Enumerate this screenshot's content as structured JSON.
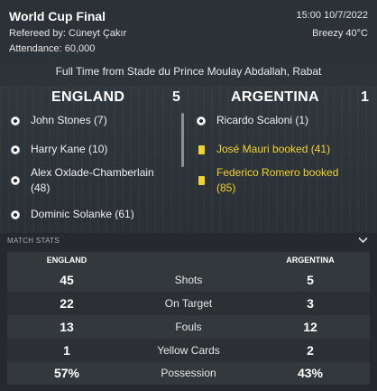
{
  "header": {
    "title": "World Cup Final",
    "referee": "Refereed by: Cüneyt Çakır",
    "attendance": "Attendance: 60,000",
    "datetime": "15:00 10/7/2022",
    "weather": "Breezy 40°C",
    "venue": "Full Time from Stade du Prince Moulay Abdallah, Rabat"
  },
  "home": {
    "name": "ENGLAND",
    "score": "5",
    "events": [
      {
        "type": "goal",
        "icon": "football-icon",
        "text": "John Stones (7)"
      },
      {
        "type": "goal",
        "icon": "football-icon",
        "text": "Harry Kane (10)"
      },
      {
        "type": "goal",
        "icon": "football-icon",
        "text": "Alex Oxlade-Chamberlain (48)"
      },
      {
        "type": "goal",
        "icon": "football-icon",
        "text": "Dominic Solanke (61)"
      }
    ]
  },
  "away": {
    "name": "ARGENTINA",
    "score": "1",
    "events": [
      {
        "type": "goal",
        "icon": "football-icon",
        "text": "Ricardo Scaloni (1)"
      },
      {
        "type": "booking",
        "icon": "yellow-card-icon",
        "text": "José Mauri booked (41)"
      },
      {
        "type": "booking",
        "icon": "yellow-card-icon",
        "text": "Federico Romero booked (85)"
      }
    ]
  },
  "stats": {
    "section_label": "MATCH STATS",
    "home_label": "ENGLAND",
    "away_label": "ARGENTINA",
    "rows": [
      {
        "name": "Shots",
        "home": "45",
        "away": "5"
      },
      {
        "name": "On Target",
        "home": "22",
        "away": "3"
      },
      {
        "name": "Fouls",
        "home": "13",
        "away": "12"
      },
      {
        "name": "Yellow Cards",
        "home": "1",
        "away": "2"
      },
      {
        "name": "Possession",
        "home": "57%",
        "away": "43%"
      }
    ]
  },
  "colors": {
    "booking_text": "#f2d22e",
    "background": "#262a2e",
    "panel": "#33383d"
  }
}
